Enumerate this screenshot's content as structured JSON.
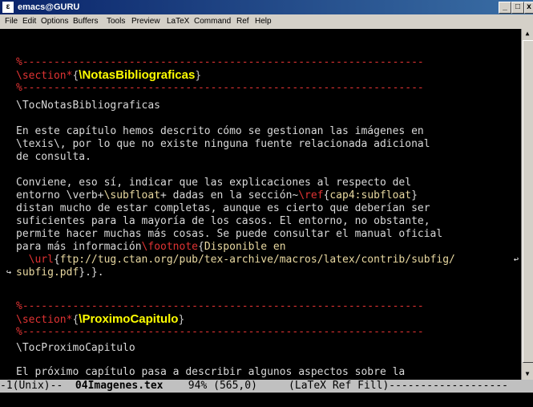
{
  "window": {
    "title": "emacs@GURU"
  },
  "menu": [
    "File",
    "Edit",
    "Options",
    "Buffers",
    "Tools",
    "Preview",
    "LaTeX",
    "Command",
    "Ref",
    "Help"
  ],
  "buffer": {
    "rule1": "%----------------------------------------------------------------",
    "sec1_cmd": "\\section*",
    "sec1_title": "\\NotasBibliograficas",
    "rule2": "%----------------------------------------------------------------",
    "line_toc1": "\\TocNotasBibliograficas",
    "p1_l1": "En este capítulo hemos descrito cómo se gestionan las imágenes en",
    "p1_l2": "\\texis\\, por lo que no existe ninguna fuente relacionada adicional",
    "p1_l3": "de consulta.",
    "p2_l1": "Conviene, eso sí, indicar que las explicaciones al respecto del",
    "p2_l2_a": "entorno \\verb+",
    "p2_l2_b": "\\subfloat",
    "p2_l2_c": "+ dadas en la sección~",
    "p2_l2_d": "\\ref",
    "p2_l2_e": "cap4:subfloat",
    "p2_l3": "distan mucho de estar completas, aunque es cierto que deberían ser",
    "p2_l4": "suficientes para la mayoría de los casos. El entorno, no obstante,",
    "p2_l5": "permite hacer muchas más cosas. Se puede consultar el manual oficial",
    "p2_l6_a": "para más información",
    "p2_l6_b": "\\footnote",
    "p2_l6_c": "Disponible en",
    "p2_l7_a": "  ",
    "p2_l7_b": "\\url",
    "p2_l7_c": "ftp://tug.ctan.org/pub/tex-archive/macros/latex/contrib/subfig/",
    "p2_l8_a": "subfig.pdf",
    "p2_l8_b": "}.}.",
    "rule3": "%----------------------------------------------------------------",
    "sec2_cmd": "\\section*",
    "sec2_title": "\\ProximoCapitulo",
    "rule4": "%----------------------------------------------------------------",
    "line_toc2": "\\TocProximoCapitulo",
    "p3_l1": "El próximo capítulo pasa a describir algunos aspectos sobre la"
  },
  "modeline": {
    "prefix": "-1(Unix)--  ",
    "filename": "04Imagenes.tex",
    "position": "    94% (565,0)     ",
    "modes": "(LaTeX Ref Fill)",
    "suffix": "-------------------"
  },
  "colors": {
    "comment": "#e03333",
    "keyword": "#ffff00",
    "argument": "#e8d8a0",
    "background": "#000000"
  }
}
